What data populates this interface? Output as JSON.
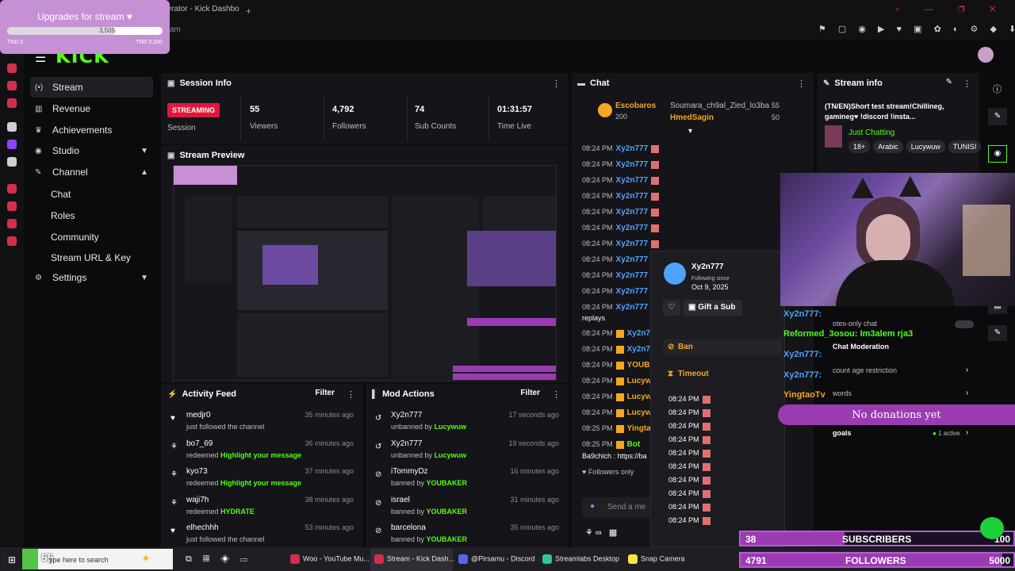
{
  "browser": {
    "tab_title": "derator - Kick Dashbo",
    "new_tab": "+",
    "window_controls": "⌕ — ❐ ✕",
    "address_fragment": "am"
  },
  "upgrades": {
    "title": "Upgrades for stream ♥",
    "current": "3,505",
    "min_label": "TND 0",
    "max_label": "TND 5,000",
    "progress_fraction": 0.701
  },
  "header": {
    "logo": "KICK"
  },
  "sidebar": {
    "items": [
      {
        "label": "Stream",
        "icon": "stream-icon"
      },
      {
        "label": "Revenue",
        "icon": "revenue-icon"
      },
      {
        "label": "Achievements",
        "icon": "trophy-icon"
      },
      {
        "label": "Studio",
        "icon": "studio-icon"
      },
      {
        "label": "Channel",
        "icon": "channel-icon"
      },
      {
        "label": "Settings",
        "icon": "gear-icon"
      }
    ],
    "channel_sub": [
      "Chat",
      "Roles",
      "Community",
      "Stream URL & Key"
    ]
  },
  "session": {
    "title": "Session Info",
    "status_badge": "STREAMING",
    "status_label": "Session",
    "viewers": "55",
    "viewers_label": "Viewers",
    "followers": "4,792",
    "followers_label": "Followers",
    "subs": "74",
    "subs_label": "Sub Counts",
    "time": "01:31:57",
    "time_label": "Time Live"
  },
  "preview": {
    "title": "Stream Preview"
  },
  "activity": {
    "title": "Activity Feed",
    "filter": "Filter",
    "rows": [
      {
        "name": "medjr0",
        "pre": "just followed the channel",
        "hl": "",
        "time": "35 minutes ago"
      },
      {
        "name": "bo7_69",
        "pre": "redeemed ",
        "hl": "Highlight your message",
        "time": "36 minutes ago"
      },
      {
        "name": "kyo73",
        "pre": "redeemed ",
        "hl": "Highlight your message",
        "time": "37 minutes ago"
      },
      {
        "name": "waji7h",
        "pre": "redeemed ",
        "hl": "HYDRATE",
        "time": "38 minutes ago"
      },
      {
        "name": "elhechhh",
        "pre": "just followed the channel",
        "hl": "",
        "time": "53 minutes ago"
      }
    ]
  },
  "modactions": {
    "title": "Mod Actions",
    "filter": "Filter",
    "rows": [
      {
        "name": "Xy2n777",
        "pre": "unbanned by ",
        "hl": "Lucywuw",
        "time": "17 seconds ago"
      },
      {
        "name": "Xy2n777",
        "pre": "unbanned by ",
        "hl": "Lucywuw",
        "time": "19 seconds ago"
      },
      {
        "name": "iTommyDz",
        "pre": "banned by ",
        "hl": "YOUBAKER",
        "time": "16 minutes ago"
      },
      {
        "name": "israel",
        "pre": "banned by ",
        "hl": "YOUBAKER",
        "time": "31 minutes ago"
      },
      {
        "name": "barcelona",
        "pre": "banned by ",
        "hl": "YOUBAKER",
        "time": "35 minutes ago"
      }
    ]
  },
  "chat": {
    "title": "Chat",
    "pinned": [
      {
        "name": "Escobaros",
        "count": "200"
      },
      {
        "name": "Soumara_ch9al_Zied_lo3ba",
        "count": "55"
      },
      {
        "name": "HmedSagin",
        "count": "50"
      }
    ],
    "lines": [
      {
        "t": "08:24 PM",
        "u": "Xy2n777"
      },
      {
        "t": "08:24 PM",
        "u": "Xy2n777"
      },
      {
        "t": "08:24 PM",
        "u": "Xy2n777"
      },
      {
        "t": "08:24 PM",
        "u": "Xy2n777"
      },
      {
        "t": "08:24 PM",
        "u": "Xy2n777"
      },
      {
        "t": "08:24 PM",
        "u": "Xy2n777"
      },
      {
        "t": "08:24 PM",
        "u": "Xy2n777"
      },
      {
        "t": "08:24 PM",
        "u": "Xy2n777"
      },
      {
        "t": "08:24 PM",
        "u": "Xy2n777"
      },
      {
        "t": "08:24 PM",
        "u": "Xy2n777"
      },
      {
        "t": "08:24 PM",
        "u": "Xy2n777"
      }
    ],
    "replays": "replays",
    "lower_lines": [
      {
        "t": "08:24 PM",
        "u": "Xy2n777"
      },
      {
        "t": "08:24 PM",
        "u": "Xy2n777"
      },
      {
        "t": "08:24 PM",
        "u": "YOUBAK"
      },
      {
        "t": "08:24 PM",
        "u": "Lucywu"
      },
      {
        "t": "08:24 PM",
        "u": "Lucywu"
      },
      {
        "t": "08:24 PM",
        "u": "Lucywu"
      },
      {
        "t": "08:25 PM",
        "u": "Yingtao"
      },
      {
        "t": "08:25 PM",
        "u": "Bot"
      }
    ],
    "last_msg": "Ba9chich : https://ba",
    "followers_only": "Followers only",
    "send_placeholder": "Send a me"
  },
  "usercard": {
    "name": "Xy2n777",
    "following_since_label": "Following since",
    "following_since": "Oct 9, 2025",
    "gift": "Gift a Sub",
    "ban": "Ban",
    "timeout": "Timeout",
    "times": [
      "08:24 PM",
      "08:24 PM",
      "08:24 PM",
      "08:24 PM",
      "08:24 PM",
      "08:24 PM",
      "08:24 PM",
      "08:24 PM",
      "08:24 PM",
      "08:24 PM"
    ]
  },
  "streaminfo": {
    "title": "Stream info",
    "stream_title": "(TN/EN)Short test stream!Chillineg, gamineg♥ !discord !insta...",
    "category": "Just Chatting",
    "tags": [
      "18+",
      "Arabic",
      "Lucywuw",
      "TUNISI"
    ]
  },
  "overlay_chat": [
    {
      "u": "Xy2n777:",
      "c": "#4ea3ff"
    },
    {
      "u": "Reformed_3osou: Im3alem rja3",
      "c": "#53fc18"
    },
    {
      "u": "Xy2n777:",
      "c": "#4ea3ff"
    },
    {
      "u": "Xy2n777:",
      "c": "#4ea3ff"
    },
    {
      "u": "YingtaoTv",
      "c": "#f5a623"
    }
  ],
  "chat_settings": {
    "emotes_only": "otes-only chat",
    "moderation": "Chat Moderation",
    "account_age": "count age restriction",
    "words": "words",
    "goals": "goals",
    "goals_active": "1 active"
  },
  "donations": "No donations yet",
  "goals": {
    "subs": {
      "current": "38",
      "label": "SUBSCRIBERS",
      "target": "100",
      "fraction": 0.38
    },
    "followers": {
      "current": "4791",
      "label": "FOLLOWERS",
      "target": "5000",
      "fraction": 0.958
    }
  },
  "taskbar": {
    "badge": "55",
    "search": "ype here to search",
    "apps": [
      "Woo - YouTube Mu...",
      "Stream - Kick Dash...",
      "@Pirsamu - Discord",
      "Streamlabs Desktop",
      "Snap Camera"
    ]
  },
  "colors": {
    "kick_green": "#53fc18",
    "live_red": "#e0173d",
    "overlay_purple": "#9a3bb1"
  }
}
